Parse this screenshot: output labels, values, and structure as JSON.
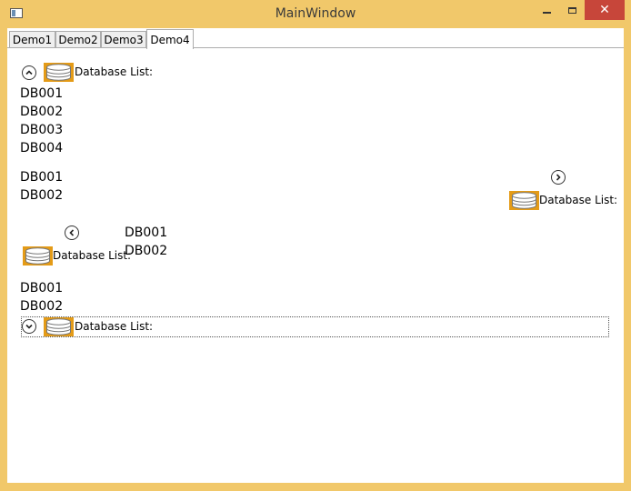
{
  "window": {
    "title": "MainWindow",
    "close_glyph": "✕"
  },
  "tabs": [
    {
      "label": "Demo1",
      "active": false
    },
    {
      "label": "Demo2",
      "active": false
    },
    {
      "label": "Demo3",
      "active": false
    },
    {
      "label": "Demo4",
      "active": true
    }
  ],
  "expanders": [
    {
      "header": "Database List:",
      "expanded": true,
      "direction": "down",
      "toggle_icon": "chevron-up-icon",
      "items": [
        "DB001",
        "DB002",
        "DB003",
        "DB004"
      ]
    },
    {
      "header": "Database List:",
      "expanded": true,
      "direction": "left",
      "toggle_icon": "chevron-right-icon",
      "items": [
        "DB001",
        "DB002"
      ]
    },
    {
      "header": "Database List:",
      "expanded": true,
      "direction": "right",
      "toggle_icon": "chevron-left-icon",
      "items": [
        "DB001",
        "DB002"
      ]
    },
    {
      "header": "Database List:",
      "expanded": true,
      "direction": "up",
      "toggle_icon": "chevron-down-icon",
      "focused": true,
      "items": [
        "DB001",
        "DB002"
      ]
    }
  ],
  "colors": {
    "window_frame": "#f1c86a",
    "close_button": "#c7463a",
    "database_icon_bg": "#e49b17"
  }
}
